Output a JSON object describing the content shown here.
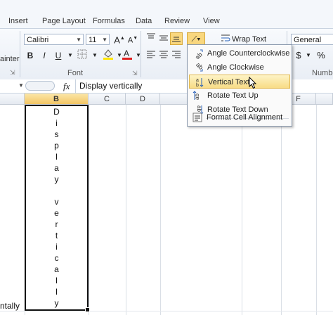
{
  "tabs": [
    "Insert",
    "Page Layout",
    "Formulas",
    "Data",
    "Review",
    "View"
  ],
  "ribbon": {
    "font_name": "Calibri",
    "font_size": "11",
    "clipboard_label": "ainter",
    "font_group_label": "Font",
    "number_group_label": "Numbe",
    "wrap_text": "Wrap Text",
    "number_format": "General",
    "bold": "B",
    "italic": "I",
    "underline": "U",
    "currency": "$",
    "percent": "%"
  },
  "formula_bar": {
    "fx": "fx",
    "value": "Display vertically"
  },
  "columns": [
    "B",
    "C",
    "D",
    "F"
  ],
  "cell_text": [
    "D",
    "i",
    "s",
    "p",
    "l",
    "a",
    "y",
    "",
    "v",
    "e",
    "r",
    "t",
    "i",
    "c",
    "a",
    "l",
    "l",
    "y"
  ],
  "left_cell_text": "ntally",
  "orientation_menu": {
    "items": [
      {
        "label": "Angle Counterclockwise",
        "icon": "angle-counterclockwise-icon"
      },
      {
        "label": "Angle Clockwise",
        "icon": "angle-clockwise-icon"
      },
      {
        "label": "Vertical Text",
        "icon": "vertical-text-icon"
      },
      {
        "label": "Rotate Text Up",
        "icon": "rotate-text-up-icon"
      },
      {
        "label": "Rotate Text Down",
        "icon": "rotate-text-down-icon"
      },
      {
        "label": "Format Cell Alignment",
        "icon": "format-cell-alignment-icon"
      }
    ],
    "highlighted": "Vertical Text"
  },
  "colors": {
    "highlight": "#f8dc86",
    "font_color_red": "#e02020",
    "fill_yellow": "#ffe600"
  }
}
